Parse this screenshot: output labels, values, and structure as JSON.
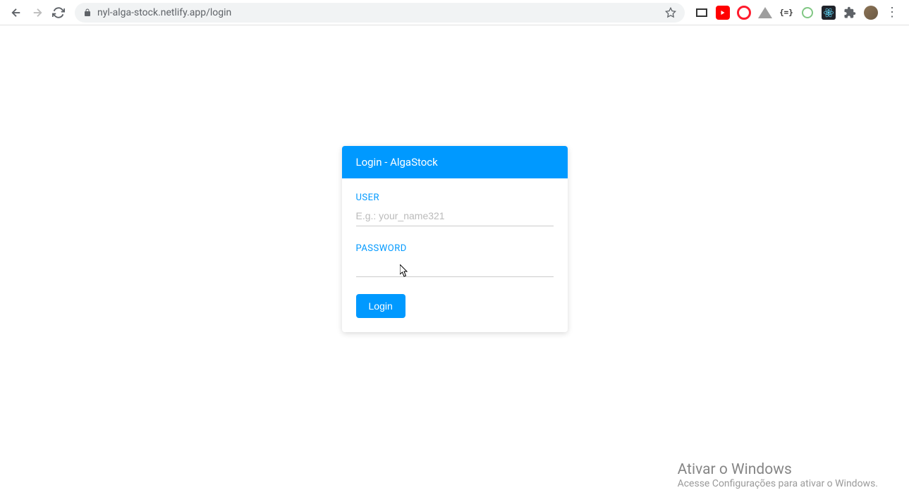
{
  "browser": {
    "url": "nyl-alga-stock.netlify.app/login"
  },
  "login": {
    "header": "Login - AlgaStock",
    "user_label": "USER",
    "user_placeholder": "E.g.: your_name321",
    "user_value": "",
    "password_label": "PASSWORD",
    "password_value": "",
    "button_label": "Login"
  },
  "watermark": {
    "title": "Ativar o Windows",
    "subtitle": "Acesse Configurações para ativar o Windows."
  }
}
